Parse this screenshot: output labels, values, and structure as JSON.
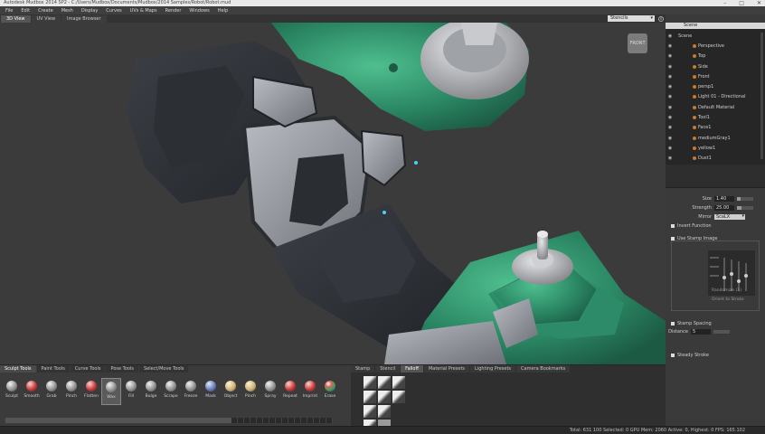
{
  "window": {
    "title": "Autodesk Mudbox 2014 SP2 - C:/Users/Mudbox/Documents/Mudbox/2014 Samples/Robot/Robot.mud",
    "controls": [
      "–",
      "□",
      "✕"
    ]
  },
  "menu": [
    "File",
    "Edit",
    "Create",
    "Mesh",
    "Display",
    "Curves",
    "UVs & Maps",
    "Render",
    "Windows",
    "Help"
  ],
  "view_tabs": [
    {
      "label": "3D View",
      "active": true
    },
    {
      "label": "UV View",
      "active": false
    },
    {
      "label": "Image Browser",
      "active": false
    }
  ],
  "viewport": {
    "camera_dropdown": "Stencils",
    "navcube_label": "FRONT"
  },
  "outliner": {
    "header": "Scene",
    "items": [
      "Scene",
      "Perspective",
      "Top",
      "Side",
      "Front",
      "persp1",
      "Light 01 - Directional",
      "Default Material",
      "Tool1",
      "Face1",
      "mediumGray1",
      "yellow1",
      "Dust1"
    ]
  },
  "properties": {
    "size_label": "Size",
    "size_value": "1.40",
    "size_fill": 0.2,
    "strength_label": "Strength",
    "strength_value": "25.00",
    "strength_fill": 0.25,
    "mirror_label": "Mirror",
    "mirror_value": "ScaLX",
    "invert_label": "Invert Function",
    "stamp_label": "Use Stamp Image",
    "stamp_options": [
      "Randomize (X)",
      "Orient to Stroke"
    ],
    "stamp_spacing_label": "Stamp Spacing",
    "distance_label": "Distance",
    "distance_value": "5",
    "steady_label": "Steady Stroke"
  },
  "shelf_tabs": [
    {
      "label": "Sculpt Tools",
      "active": true
    },
    {
      "label": "Paint Tools",
      "active": false
    },
    {
      "label": "Curve Tools",
      "active": false
    },
    {
      "label": "Pose Tools",
      "active": false
    },
    {
      "label": "Select/Move Tools",
      "active": false
    }
  ],
  "tools": [
    {
      "label": "Sculpt",
      "style": ""
    },
    {
      "label": "Smooth",
      "style": "red"
    },
    {
      "label": "Grab",
      "style": ""
    },
    {
      "label": "Pinch",
      "style": ""
    },
    {
      "label": "Flatten",
      "style": "red"
    },
    {
      "label": "Wax",
      "style": "",
      "selected": true
    },
    {
      "label": "Fill",
      "style": ""
    },
    {
      "label": "Bulge",
      "style": ""
    },
    {
      "label": "Scrape",
      "style": ""
    },
    {
      "label": "Freeze",
      "style": ""
    },
    {
      "label": "Mask",
      "style": "blue"
    },
    {
      "label": "Object",
      "style": "tan"
    },
    {
      "label": "Pinch",
      "style": "tan"
    },
    {
      "label": "Spray",
      "style": ""
    },
    {
      "label": "Repeat",
      "style": "red"
    },
    {
      "label": "Imprint",
      "style": "red"
    },
    {
      "label": "Erase",
      "style": "multi"
    }
  ],
  "stamp_tabs": [
    {
      "label": "Stamp",
      "active": false
    },
    {
      "label": "Stencil",
      "active": false
    },
    {
      "label": "Falloff",
      "active": true
    },
    {
      "label": "Material Presets",
      "active": false
    },
    {
      "label": "Lighting Presets",
      "active": false
    },
    {
      "label": "Camera Bookmarks",
      "active": false
    }
  ],
  "status": "Total: 631 100  Selected: 0 GPU Mem: 2060  Active: 0, Highest: 0  FPS: 165.102",
  "colors": {
    "teal": "#2e8b6a",
    "metal": "#8a8d92",
    "dark": "#2f3237",
    "bg": "#3b3b3b"
  }
}
